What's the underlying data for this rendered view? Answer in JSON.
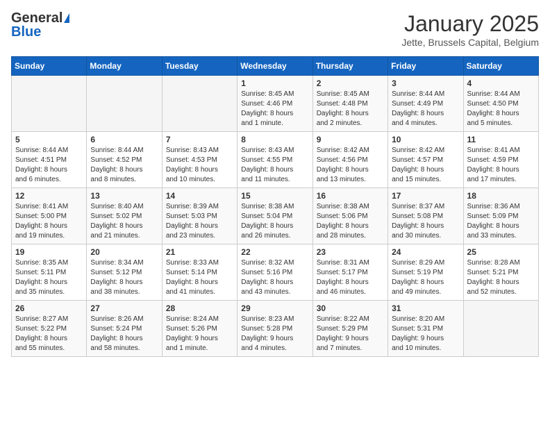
{
  "logo": {
    "general": "General",
    "blue": "Blue"
  },
  "header": {
    "month": "January 2025",
    "location": "Jette, Brussels Capital, Belgium"
  },
  "weekdays": [
    "Sunday",
    "Monday",
    "Tuesday",
    "Wednesday",
    "Thursday",
    "Friday",
    "Saturday"
  ],
  "weeks": [
    [
      {
        "day": "",
        "info": ""
      },
      {
        "day": "",
        "info": ""
      },
      {
        "day": "",
        "info": ""
      },
      {
        "day": "1",
        "info": "Sunrise: 8:45 AM\nSunset: 4:46 PM\nDaylight: 8 hours\nand 1 minute."
      },
      {
        "day": "2",
        "info": "Sunrise: 8:45 AM\nSunset: 4:48 PM\nDaylight: 8 hours\nand 2 minutes."
      },
      {
        "day": "3",
        "info": "Sunrise: 8:44 AM\nSunset: 4:49 PM\nDaylight: 8 hours\nand 4 minutes."
      },
      {
        "day": "4",
        "info": "Sunrise: 8:44 AM\nSunset: 4:50 PM\nDaylight: 8 hours\nand 5 minutes."
      }
    ],
    [
      {
        "day": "5",
        "info": "Sunrise: 8:44 AM\nSunset: 4:51 PM\nDaylight: 8 hours\nand 6 minutes."
      },
      {
        "day": "6",
        "info": "Sunrise: 8:44 AM\nSunset: 4:52 PM\nDaylight: 8 hours\nand 8 minutes."
      },
      {
        "day": "7",
        "info": "Sunrise: 8:43 AM\nSunset: 4:53 PM\nDaylight: 8 hours\nand 10 minutes."
      },
      {
        "day": "8",
        "info": "Sunrise: 8:43 AM\nSunset: 4:55 PM\nDaylight: 8 hours\nand 11 minutes."
      },
      {
        "day": "9",
        "info": "Sunrise: 8:42 AM\nSunset: 4:56 PM\nDaylight: 8 hours\nand 13 minutes."
      },
      {
        "day": "10",
        "info": "Sunrise: 8:42 AM\nSunset: 4:57 PM\nDaylight: 8 hours\nand 15 minutes."
      },
      {
        "day": "11",
        "info": "Sunrise: 8:41 AM\nSunset: 4:59 PM\nDaylight: 8 hours\nand 17 minutes."
      }
    ],
    [
      {
        "day": "12",
        "info": "Sunrise: 8:41 AM\nSunset: 5:00 PM\nDaylight: 8 hours\nand 19 minutes."
      },
      {
        "day": "13",
        "info": "Sunrise: 8:40 AM\nSunset: 5:02 PM\nDaylight: 8 hours\nand 21 minutes."
      },
      {
        "day": "14",
        "info": "Sunrise: 8:39 AM\nSunset: 5:03 PM\nDaylight: 8 hours\nand 23 minutes."
      },
      {
        "day": "15",
        "info": "Sunrise: 8:38 AM\nSunset: 5:04 PM\nDaylight: 8 hours\nand 26 minutes."
      },
      {
        "day": "16",
        "info": "Sunrise: 8:38 AM\nSunset: 5:06 PM\nDaylight: 8 hours\nand 28 minutes."
      },
      {
        "day": "17",
        "info": "Sunrise: 8:37 AM\nSunset: 5:08 PM\nDaylight: 8 hours\nand 30 minutes."
      },
      {
        "day": "18",
        "info": "Sunrise: 8:36 AM\nSunset: 5:09 PM\nDaylight: 8 hours\nand 33 minutes."
      }
    ],
    [
      {
        "day": "19",
        "info": "Sunrise: 8:35 AM\nSunset: 5:11 PM\nDaylight: 8 hours\nand 35 minutes."
      },
      {
        "day": "20",
        "info": "Sunrise: 8:34 AM\nSunset: 5:12 PM\nDaylight: 8 hours\nand 38 minutes."
      },
      {
        "day": "21",
        "info": "Sunrise: 8:33 AM\nSunset: 5:14 PM\nDaylight: 8 hours\nand 41 minutes."
      },
      {
        "day": "22",
        "info": "Sunrise: 8:32 AM\nSunset: 5:16 PM\nDaylight: 8 hours\nand 43 minutes."
      },
      {
        "day": "23",
        "info": "Sunrise: 8:31 AM\nSunset: 5:17 PM\nDaylight: 8 hours\nand 46 minutes."
      },
      {
        "day": "24",
        "info": "Sunrise: 8:29 AM\nSunset: 5:19 PM\nDaylight: 8 hours\nand 49 minutes."
      },
      {
        "day": "25",
        "info": "Sunrise: 8:28 AM\nSunset: 5:21 PM\nDaylight: 8 hours\nand 52 minutes."
      }
    ],
    [
      {
        "day": "26",
        "info": "Sunrise: 8:27 AM\nSunset: 5:22 PM\nDaylight: 8 hours\nand 55 minutes."
      },
      {
        "day": "27",
        "info": "Sunrise: 8:26 AM\nSunset: 5:24 PM\nDaylight: 8 hours\nand 58 minutes."
      },
      {
        "day": "28",
        "info": "Sunrise: 8:24 AM\nSunset: 5:26 PM\nDaylight: 9 hours\nand 1 minute."
      },
      {
        "day": "29",
        "info": "Sunrise: 8:23 AM\nSunset: 5:28 PM\nDaylight: 9 hours\nand 4 minutes."
      },
      {
        "day": "30",
        "info": "Sunrise: 8:22 AM\nSunset: 5:29 PM\nDaylight: 9 hours\nand 7 minutes."
      },
      {
        "day": "31",
        "info": "Sunrise: 8:20 AM\nSunset: 5:31 PM\nDaylight: 9 hours\nand 10 minutes."
      },
      {
        "day": "",
        "info": ""
      }
    ]
  ]
}
